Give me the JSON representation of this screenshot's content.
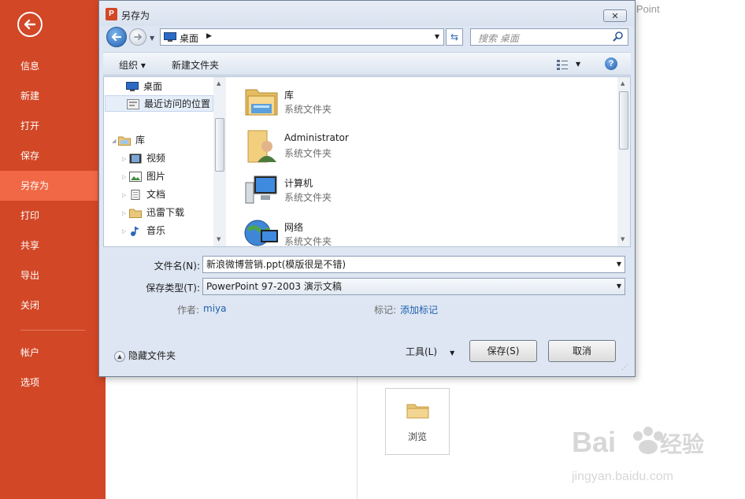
{
  "app": {
    "brand_partial": "Point"
  },
  "sidebar": {
    "items": [
      {
        "label": "信息"
      },
      {
        "label": "新建"
      },
      {
        "label": "打开"
      },
      {
        "label": "保存"
      },
      {
        "label": "另存为"
      },
      {
        "label": "打印"
      },
      {
        "label": "共享"
      },
      {
        "label": "导出"
      },
      {
        "label": "关闭"
      },
      {
        "label": "帐户"
      },
      {
        "label": "选项"
      }
    ],
    "active": "另存为",
    "bg_color": "#d24726",
    "active_color": "#f06845"
  },
  "browse": {
    "label": "浏览"
  },
  "dialog": {
    "icon_letter": "P",
    "title": "另存为",
    "close_glyph": "✕",
    "address": {
      "location": "桌面"
    },
    "search": {
      "placeholder": "搜索 桌面"
    },
    "toolbar": {
      "organize": "组织 ▾",
      "new_folder": "新建文件夹",
      "help": "?"
    },
    "tree": {
      "items": [
        {
          "label": "桌面",
          "icon": "desktop-icon"
        },
        {
          "label": "最近访问的位置",
          "icon": "recent-places-icon"
        },
        {
          "label": "库",
          "icon": "library-icon"
        },
        {
          "label": "视频",
          "icon": "video-icon"
        },
        {
          "label": "图片",
          "icon": "picture-icon"
        },
        {
          "label": "文档",
          "icon": "document-icon"
        },
        {
          "label": "迅雷下载",
          "icon": "download-icon"
        },
        {
          "label": "音乐",
          "icon": "music-icon"
        }
      ]
    },
    "files": [
      {
        "name": "库",
        "type": "系统文件夹",
        "icon": "library-folder-icon"
      },
      {
        "name": "Administrator",
        "type": "系统文件夹",
        "icon": "user-folder-icon"
      },
      {
        "name": "计算机",
        "type": "系统文件夹",
        "icon": "computer-icon"
      },
      {
        "name": "网络",
        "type": "系统文件夹",
        "icon": "network-icon"
      }
    ],
    "filename": {
      "label": "文件名(N):",
      "value": "新浪微博营销.ppt(模版很是不错)"
    },
    "filetype": {
      "label": "保存类型(T):",
      "value": "PowerPoint 97-2003 演示文稿"
    },
    "meta": {
      "author_label": "作者:",
      "author_value": "miya",
      "tags_label": "标记:",
      "tags_value": "添加标记"
    },
    "hide_folders": "隐藏文件夹",
    "tools": "工具(L)",
    "save": "保存(S)",
    "cancel": "取消"
  }
}
